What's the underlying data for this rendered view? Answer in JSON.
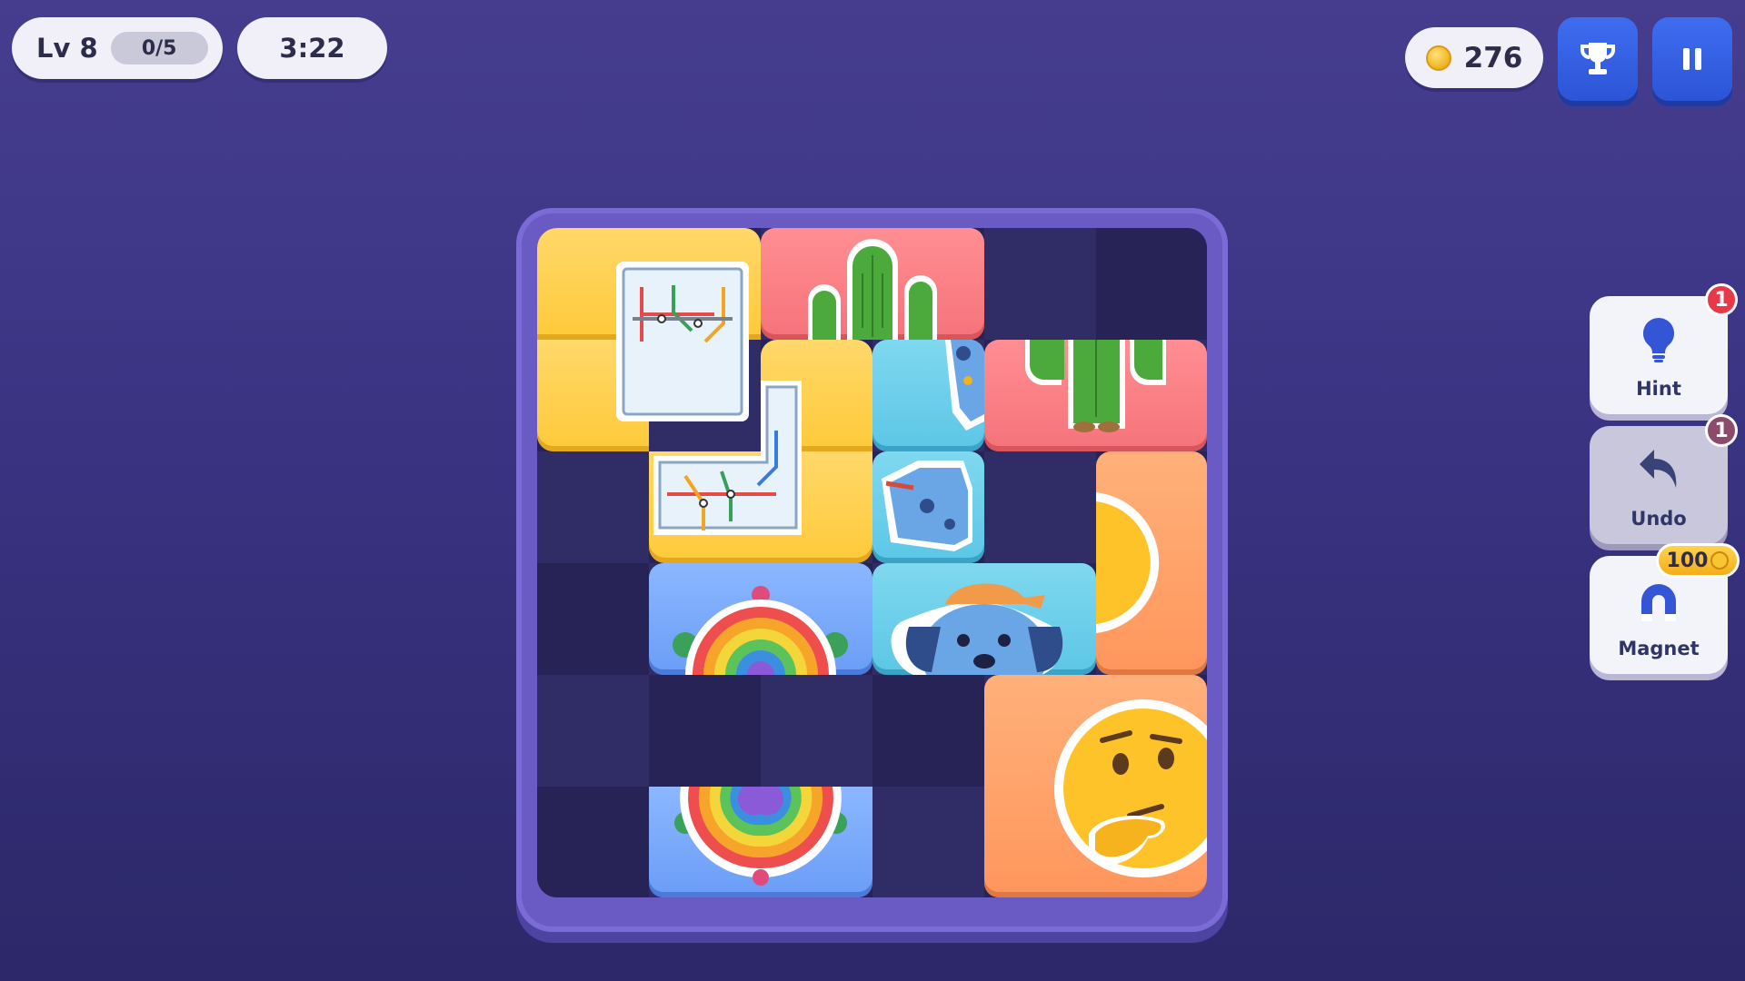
{
  "hud": {
    "level_label": "Lv 8",
    "progress": "0/5",
    "timer": "3:22",
    "coins": "276"
  },
  "buttons": {
    "trophy_icon": "trophy-icon",
    "pause_icon": "pause-icon"
  },
  "powerups": [
    {
      "label": "Hint",
      "badge": "1",
      "icon": "lightbulb-icon",
      "enabled": true
    },
    {
      "label": "Undo",
      "badge": "1",
      "icon": "undo-arrow-icon",
      "enabled": false
    },
    {
      "label": "Magnet",
      "cost": "100",
      "icon": "magnet-icon",
      "enabled": true
    }
  ],
  "board": {
    "size": "6x6",
    "tiles": [
      {
        "picture": "subway-map",
        "color": "#ffca3a"
      },
      {
        "picture": "subway-map",
        "color": "#ffca3a"
      },
      {
        "picture": "cactus",
        "color": "#f5737a"
      },
      {
        "picture": "cactus",
        "color": "#f5737a"
      },
      {
        "picture": "puppy",
        "color": "#5cc6e6"
      },
      {
        "picture": "puppy",
        "color": "#5cc6e6"
      },
      {
        "picture": "puppy",
        "color": "#5cc6e6"
      },
      {
        "picture": "sun-emoji",
        "color": "#ff965c"
      },
      {
        "picture": "thinking-face-emoji",
        "color": "#ff965c"
      },
      {
        "picture": "rainbow-turtle",
        "color": "#6a9df7"
      },
      {
        "picture": "rainbow-turtle",
        "color": "#6a9df7"
      },
      {
        "picture": "rainbow-turtle",
        "color": "#6a9df7"
      }
    ]
  }
}
